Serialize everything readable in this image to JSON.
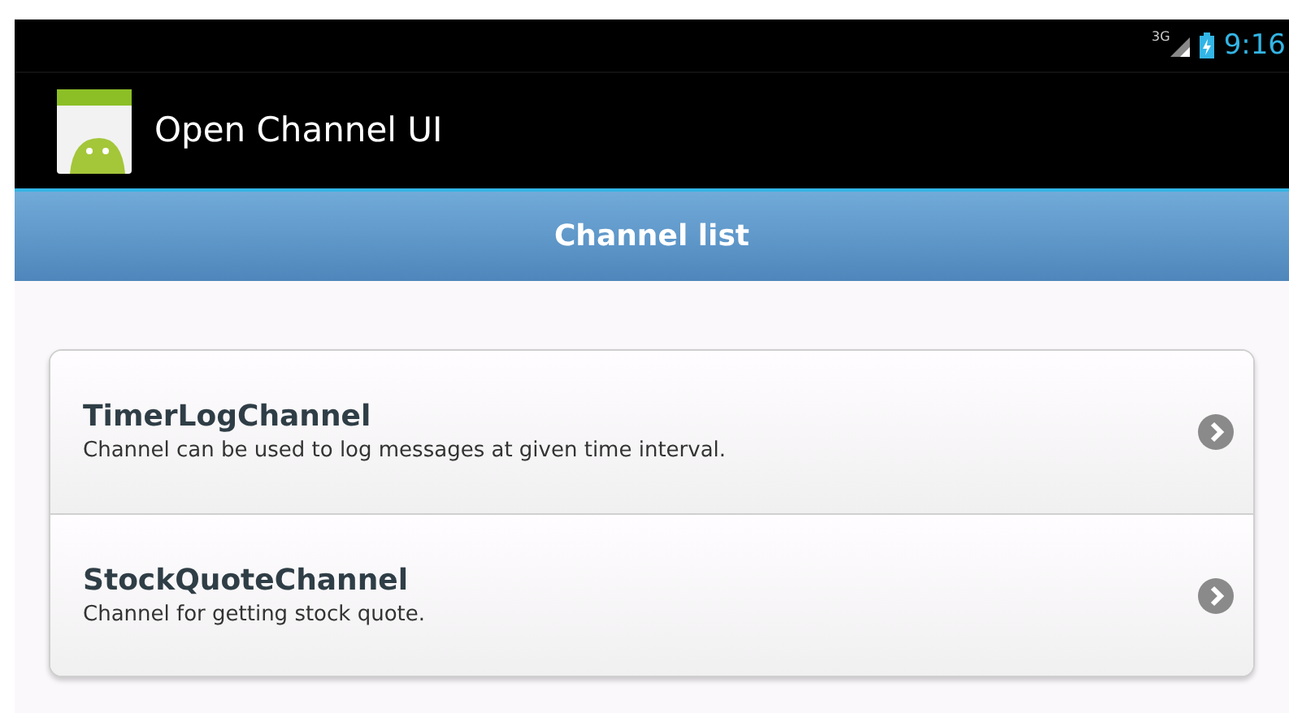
{
  "status_bar": {
    "network": "3G",
    "time": "9:16"
  },
  "action_bar": {
    "title": "Open Channel UI"
  },
  "header": {
    "title": "Channel list"
  },
  "channels": [
    {
      "name": "TimerLogChannel",
      "description": "Channel can be used to log messages at given time interval."
    },
    {
      "name": "StockQuoteChannel",
      "description": "Channel for getting stock quote."
    }
  ]
}
